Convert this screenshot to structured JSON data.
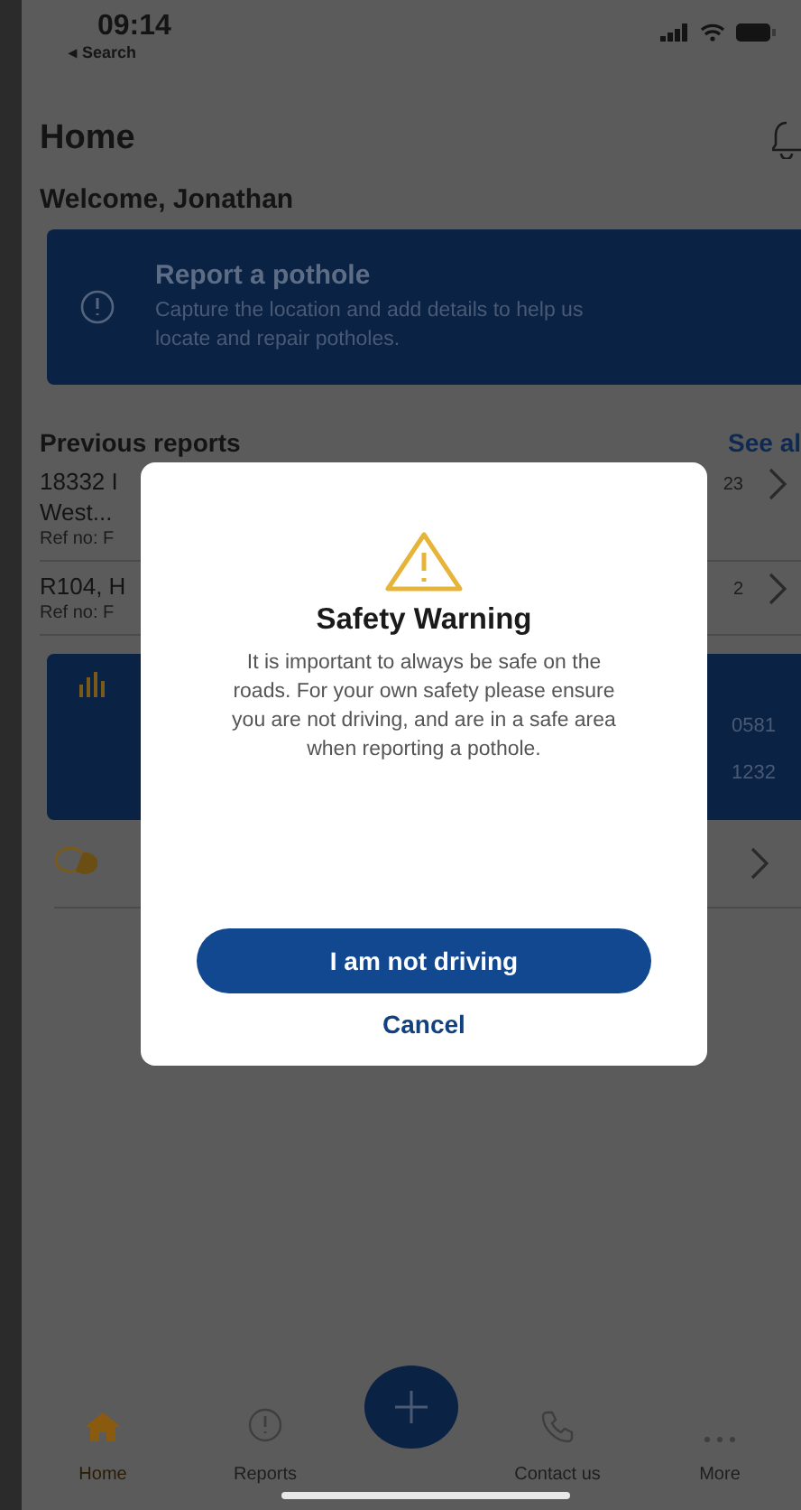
{
  "status_bar": {
    "time": "09:14",
    "back_label": "◂ Search"
  },
  "header": {
    "title": "Home"
  },
  "welcome": "Welcome, Jonathan",
  "report_card": {
    "title": "Report a pothole",
    "text": "Capture the location and add details to help us locate and repair potholes."
  },
  "previous_reports": {
    "title": "Previous reports",
    "link": "See al",
    "rows": [
      {
        "lines": [
          "18332 I",
          "West..."
        ],
        "ref": "Ref no: F",
        "date": "23"
      },
      {
        "lines": [
          "R104, H"
        ],
        "ref": "Ref no: F",
        "date": "2"
      }
    ]
  },
  "stats_card": {
    "values": [
      "0581",
      "1232"
    ]
  },
  "dialog": {
    "title": "Safety Warning",
    "text": "It is important to always be safe on the roads. For your own safety please ensure you are not driving, and are in a safe area when reporting a pothole.",
    "primary": "I am not driving",
    "secondary": "Cancel"
  },
  "tab_bar": {
    "items": [
      {
        "label": "Home",
        "kind": "home",
        "selected": true
      },
      {
        "label": "Reports",
        "kind": "reports",
        "selected": false
      },
      {
        "kind": "add",
        "selected": false
      },
      {
        "label": "Contact us",
        "kind": "contact",
        "selected": false
      },
      {
        "label": "More",
        "kind": "more",
        "selected": false
      }
    ]
  }
}
